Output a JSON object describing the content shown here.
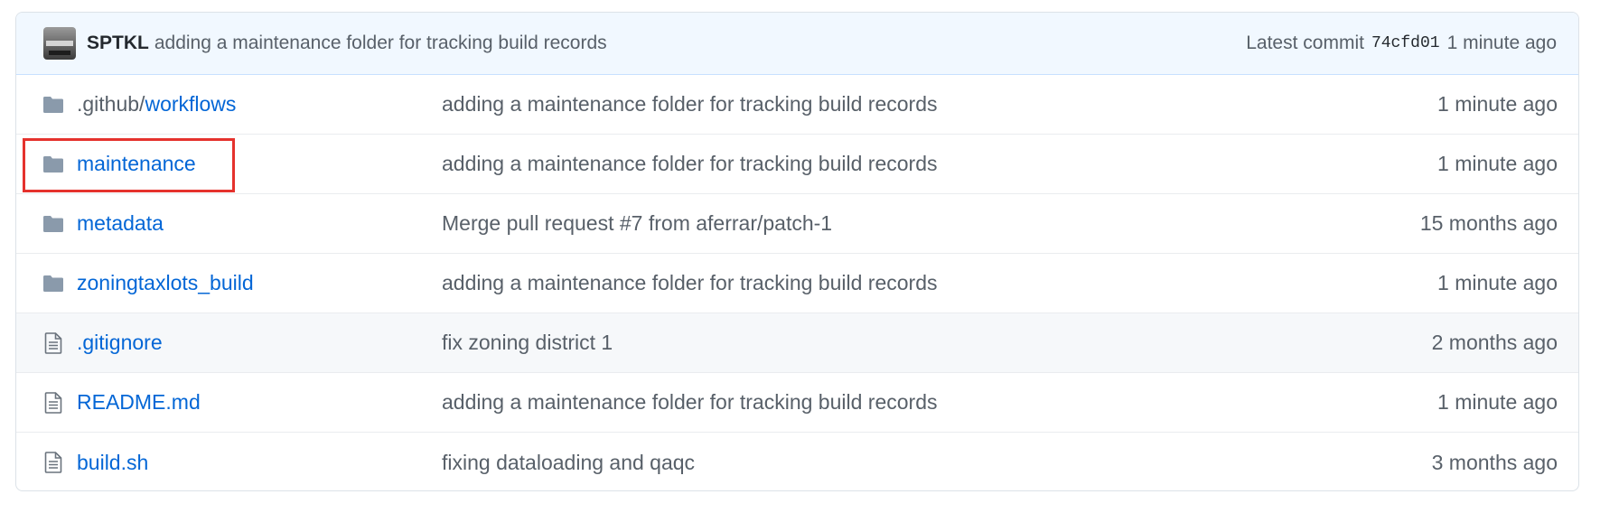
{
  "colors": {
    "link": "#0366d6",
    "muted": "#586069",
    "header_bg": "#f1f8ff",
    "folder_icon": "#79b8ff",
    "highlight": "#e5322d"
  },
  "latest_commit": {
    "author": "SPTKL",
    "message": "adding a maintenance folder for tracking build records",
    "label": "Latest commit",
    "sha": "74cfd01",
    "age": "1 minute ago"
  },
  "files": [
    {
      "type": "folder",
      "icon": "folder-icon",
      "prefix": ".github/",
      "name": "workflows",
      "message": "adding a maintenance folder for tracking build records",
      "age": "1 minute ago"
    },
    {
      "type": "folder",
      "icon": "folder-icon",
      "prefix": "",
      "name": "maintenance",
      "message": "adding a maintenance folder for tracking build records",
      "age": "1 minute ago"
    },
    {
      "type": "folder",
      "icon": "folder-icon",
      "prefix": "",
      "name": "metadata",
      "message": "Merge pull request #7 from aferrar/patch-1",
      "age": "15 months ago"
    },
    {
      "type": "folder",
      "icon": "folder-icon",
      "prefix": "",
      "name": "zoningtaxlots_build",
      "message": "adding a maintenance folder for tracking build records",
      "age": "1 minute ago"
    },
    {
      "type": "file",
      "icon": "file-icon",
      "prefix": "",
      "name": ".gitignore",
      "message": "fix zoning district 1",
      "age": "2 months ago"
    },
    {
      "type": "file",
      "icon": "file-icon",
      "prefix": "",
      "name": "README.md",
      "message": "adding a maintenance folder for tracking build records",
      "age": "1 minute ago"
    },
    {
      "type": "file",
      "icon": "file-icon",
      "prefix": "",
      "name": "build.sh",
      "message": "fixing dataloading and qaqc",
      "age": "3 months ago"
    }
  ]
}
